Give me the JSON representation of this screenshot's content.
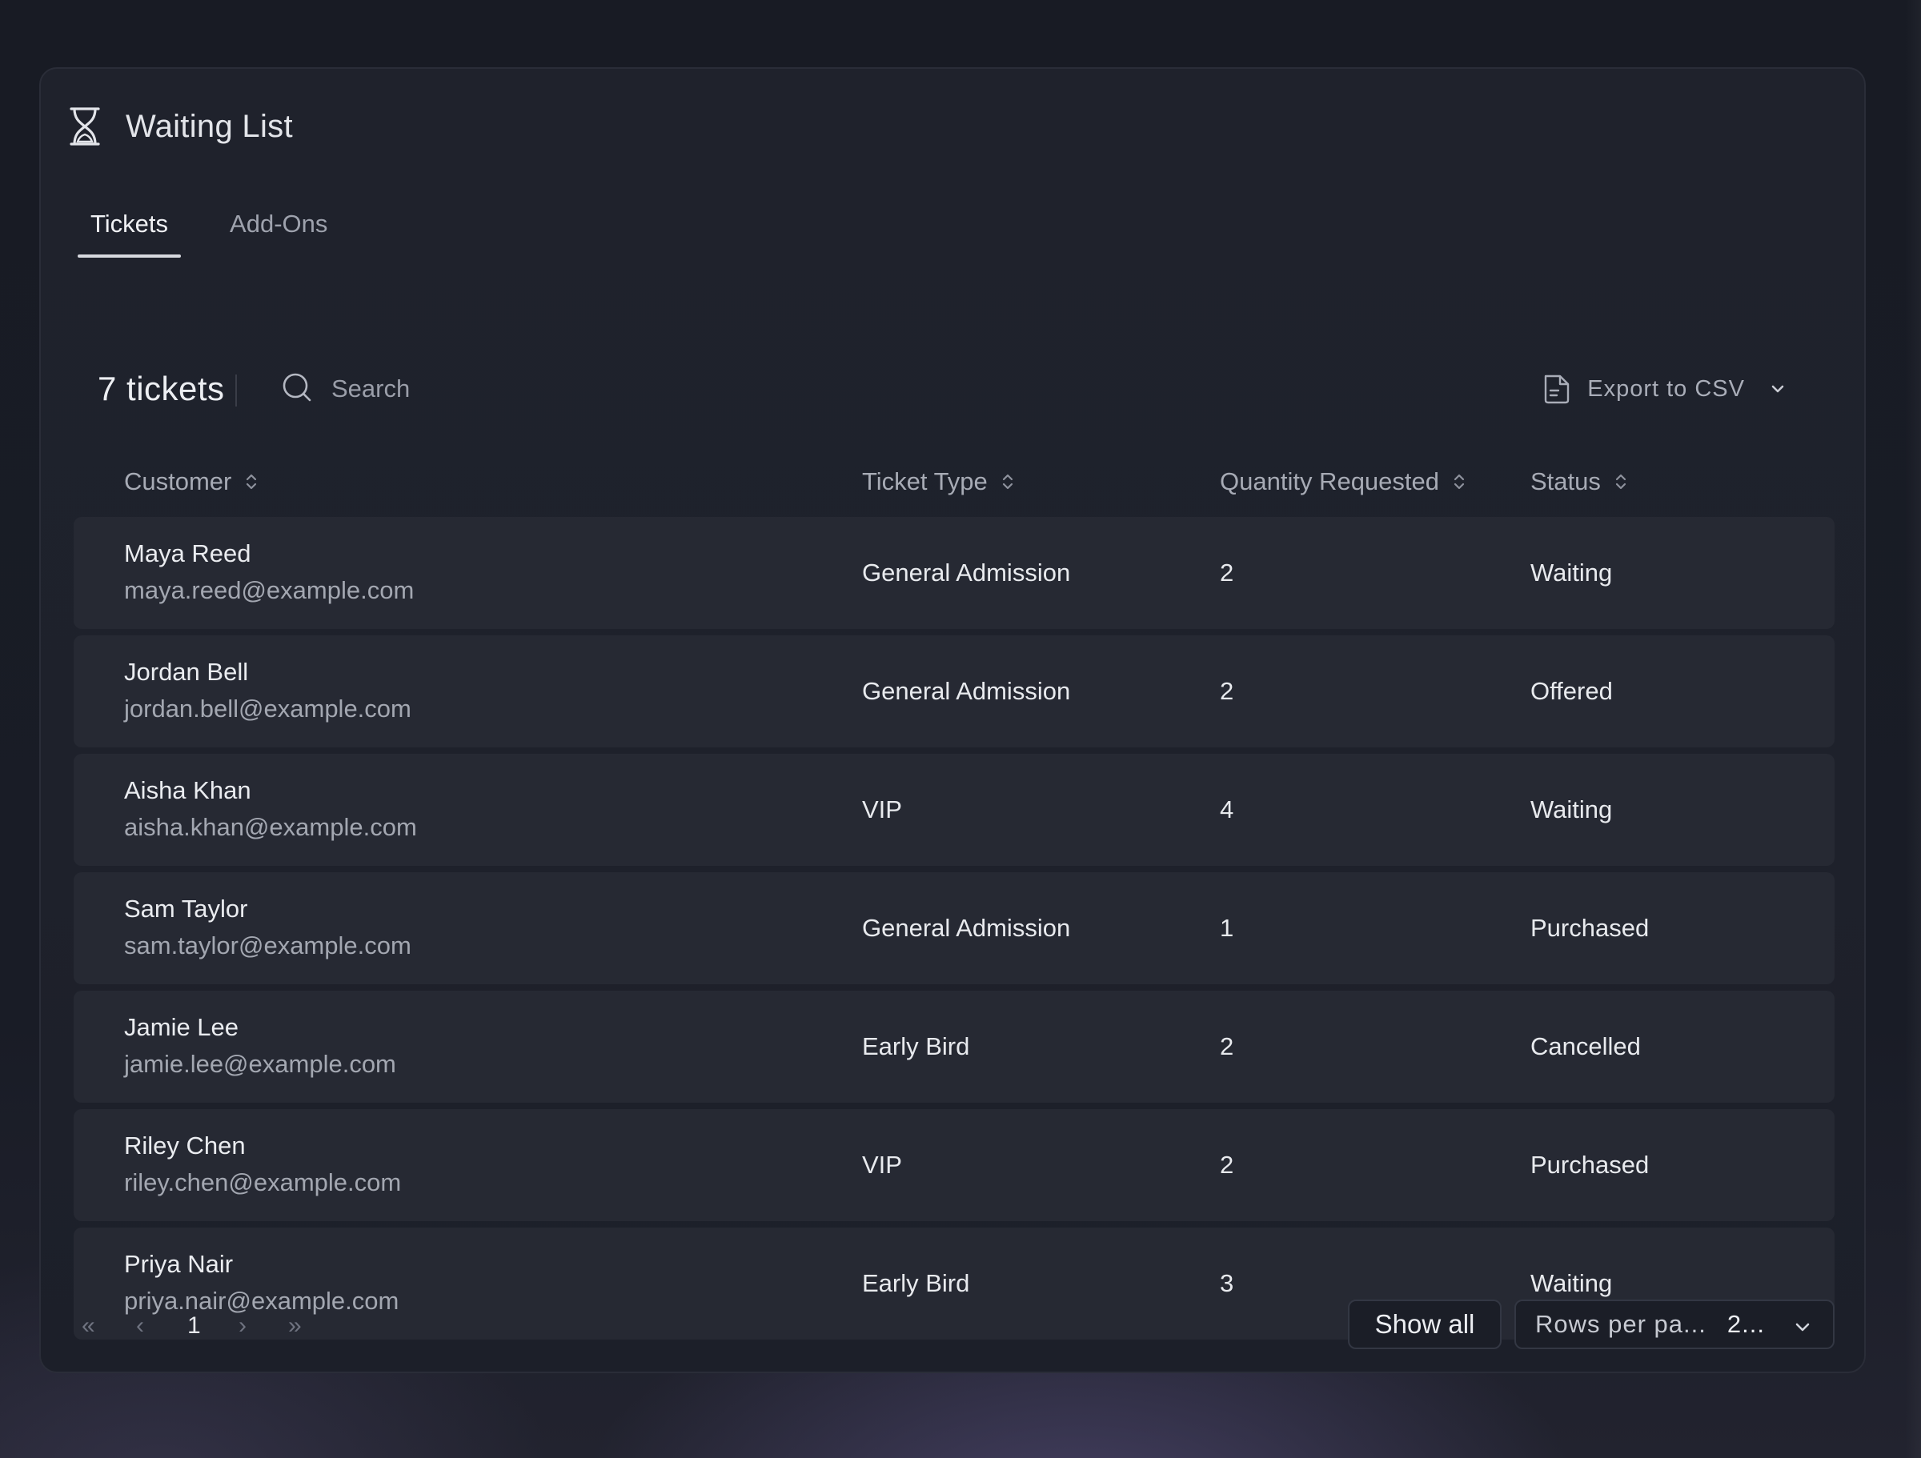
{
  "header": {
    "title": "Waiting List",
    "icon": "hourglass-icon"
  },
  "tabs": [
    {
      "label": "Tickets",
      "active": true
    },
    {
      "label": "Add-Ons",
      "active": false
    }
  ],
  "toolbar": {
    "count_label": "7 tickets",
    "search_placeholder": "Search",
    "export_label": "Export to CSV"
  },
  "table": {
    "columns": [
      "Customer",
      "Ticket Type",
      "Quantity Requested",
      "Status"
    ],
    "rows": [
      {
        "name": "Maya Reed",
        "email": "maya.reed@example.com",
        "ticket_type": "General Admission",
        "quantity": "2",
        "status": "Waiting"
      },
      {
        "name": "Jordan Bell",
        "email": "jordan.bell@example.com",
        "ticket_type": "General Admission",
        "quantity": "2",
        "status": "Offered"
      },
      {
        "name": "Aisha Khan",
        "email": "aisha.khan@example.com",
        "ticket_type": "VIP",
        "quantity": "4",
        "status": "Waiting"
      },
      {
        "name": "Sam Taylor",
        "email": "sam.taylor@example.com",
        "ticket_type": "General Admission",
        "quantity": "1",
        "status": "Purchased"
      },
      {
        "name": "Jamie Lee",
        "email": "jamie.lee@example.com",
        "ticket_type": "Early Bird",
        "quantity": "2",
        "status": "Cancelled"
      },
      {
        "name": "Riley Chen",
        "email": "riley.chen@example.com",
        "ticket_type": "VIP",
        "quantity": "2",
        "status": "Purchased"
      },
      {
        "name": "Priya Nair",
        "email": "priya.nair@example.com",
        "ticket_type": "Early Bird",
        "quantity": "3",
        "status": "Waiting"
      }
    ]
  },
  "pagination": {
    "first": "«",
    "prev": "‹",
    "current_page": "1",
    "next": "›",
    "last": "»",
    "show_all_label": "Show all",
    "rows_per_page_label": "Rows per pa...",
    "rows_per_page_value": "2..."
  },
  "colors": {
    "background": "#191c26",
    "panel": "#1f222c",
    "row": "#262933",
    "text": "#e8eaee",
    "muted_text": "#a3a7b1"
  }
}
